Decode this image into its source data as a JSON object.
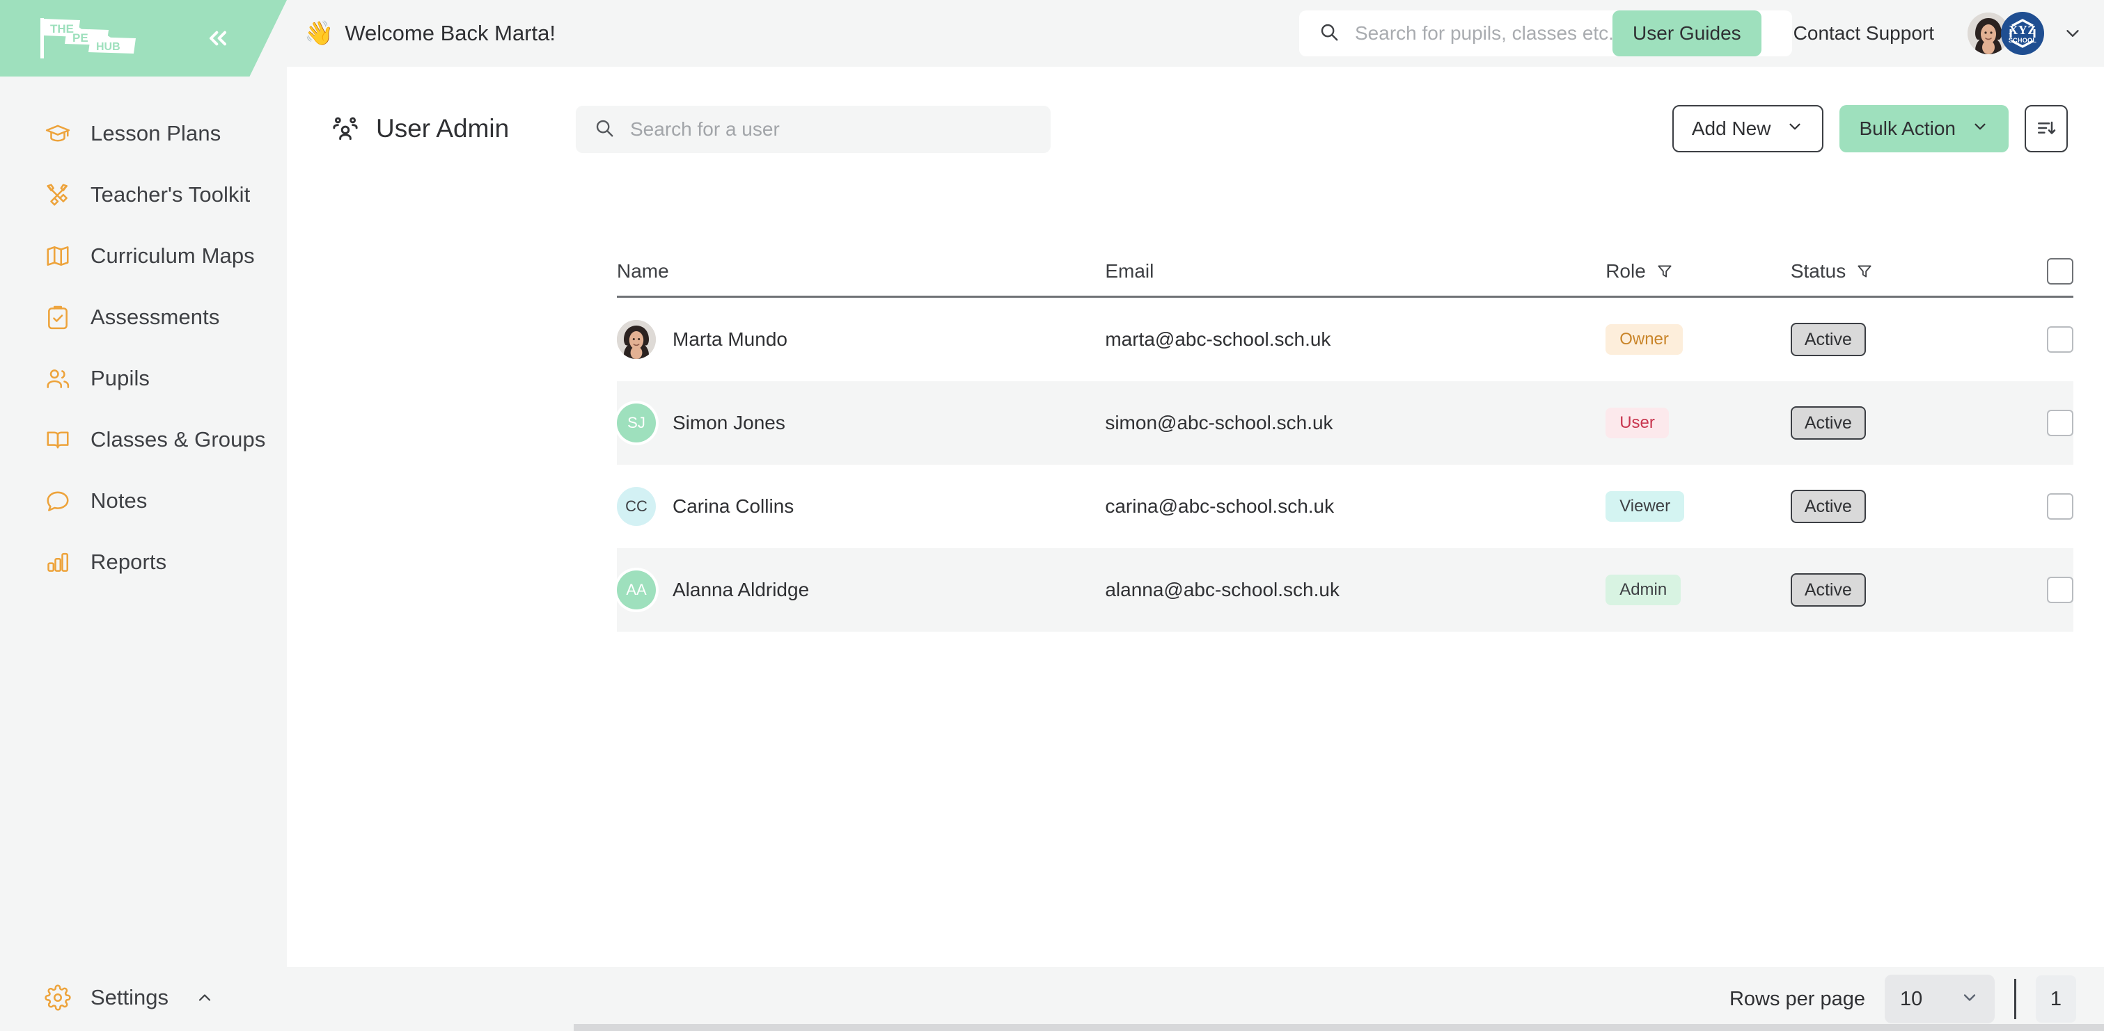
{
  "sidebar": {
    "logo": {
      "line1": "THE",
      "line2": "PE",
      "line3": "HUB"
    },
    "collapse_label": "collapse-sidebar",
    "items": [
      {
        "label": "Lesson Plans",
        "icon": "graduation-cap-icon"
      },
      {
        "label": "Teacher's Toolkit",
        "icon": "tools-icon"
      },
      {
        "label": "Curriculum Maps",
        "icon": "map-icon"
      },
      {
        "label": "Assessments",
        "icon": "clipboard-check-icon"
      },
      {
        "label": "Pupils",
        "icon": "users-icon"
      },
      {
        "label": "Classes & Groups",
        "icon": "open-book-icon"
      },
      {
        "label": "Notes",
        "icon": "speech-bubble-icon"
      },
      {
        "label": "Reports",
        "icon": "bar-chart-icon"
      }
    ],
    "settings": {
      "label": "Settings",
      "icon": "gear-icon"
    }
  },
  "topbar": {
    "wave_emoji": "👋",
    "welcome": "Welcome Back Marta!",
    "search_placeholder": "Search for pupils, classes etc...",
    "search_value": "",
    "user_guides_label": "User Guides",
    "contact_support_label": "Contact Support",
    "school_badge": {
      "name": "XYZ",
      "sub": "SCHOOL"
    }
  },
  "page": {
    "title": "User Admin",
    "search_placeholder": "Search for a user",
    "search_value": "",
    "add_new_label": "Add New",
    "bulk_action_label": "Bulk Action",
    "sort_label": "sort"
  },
  "table": {
    "columns": [
      "Name",
      "Email",
      "Role",
      "Status"
    ],
    "rows": [
      {
        "name": "Marta Mundo",
        "email": "marta@abc-school.sch.uk",
        "role": "Owner",
        "role_bg": "#fdeedb",
        "role_fg": "#c9852a",
        "status": "Active",
        "avatar_initials": "",
        "avatar_bg": "#ded9d4",
        "avatar_type": "photo"
      },
      {
        "name": "Simon Jones",
        "email": "simon@abc-school.sch.uk",
        "role": "User",
        "role_bg": "#fce9ec",
        "role_fg": "#c8364f",
        "status": "Active",
        "avatar_initials": "SJ",
        "avatar_bg": "#9ee0bd",
        "avatar_type": "initials"
      },
      {
        "name": "Carina Collins",
        "email": "carina@abc-school.sch.uk",
        "role": "Viewer",
        "role_bg": "#d4f4f2",
        "role_fg": "#3e4044",
        "status": "Active",
        "avatar_initials": "CC",
        "avatar_bg": "#d3f1f4",
        "avatar_type": "initials-dark"
      },
      {
        "name": "Alanna Aldridge",
        "email": "alanna@abc-school.sch.uk",
        "role": "Admin",
        "role_bg": "#d8f3e2",
        "role_fg": "#3e4044",
        "status": "Active",
        "avatar_initials": "AA",
        "avatar_bg": "#9ee0bd",
        "avatar_type": "initials"
      }
    ]
  },
  "footer": {
    "rows_per_page_label": "Rows per page",
    "rows_per_page_value": "10",
    "current_page": "1"
  },
  "colors": {
    "brand_green": "#9ee0bd",
    "accent_orange": "#eda33b",
    "panel_grey": "#f4f5f5",
    "text_dark": "#2f3033",
    "navy": "#1f4e91"
  }
}
